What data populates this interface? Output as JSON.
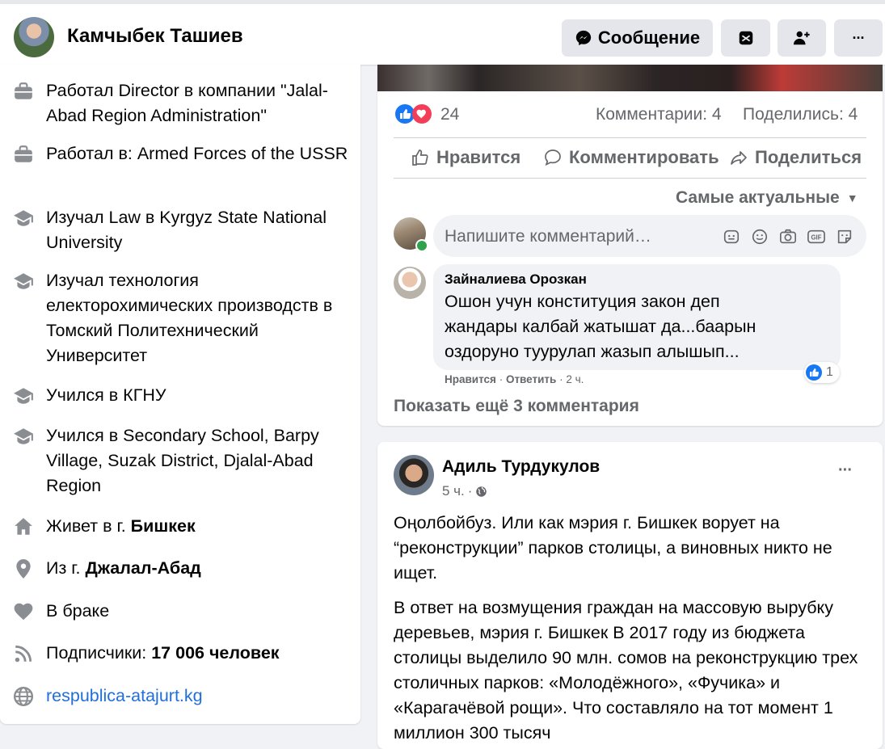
{
  "header": {
    "name": "Камчыбек Ташиев",
    "message_label": "Сообщение",
    "avatar_icon": "profile-avatar",
    "buttons": [
      "messenger-icon",
      "inbox-icon",
      "add-friend-icon",
      "more-icon"
    ],
    "more_label": "···"
  },
  "about": {
    "items": [
      {
        "icon": "briefcase-icon",
        "text": "Работал Director в компании \"Jalal-Abad Region Administration\""
      },
      {
        "icon": "briefcase-icon",
        "text": "Работал в: Armed Forces of the USSR"
      },
      {
        "icon": "graduation-cap-icon",
        "text": "Изучал Law в Kyrgyz State National University"
      },
      {
        "icon": "graduation-cap-icon",
        "text": "Изучал технология електорохимических производств в Томский Политехнический Университет"
      },
      {
        "icon": "graduation-cap-icon",
        "text": "Учился в КГНУ"
      },
      {
        "icon": "graduation-cap-icon",
        "text": "Учился в Secondary School, Barpy Village, Suzak District, Djalal-Abad Region"
      },
      {
        "icon": "home-icon",
        "text_prefix": "Живет в г. ",
        "text_bold": "Бишкек"
      },
      {
        "icon": "location-icon",
        "text_prefix": "Из г. ",
        "text_bold": "Джалал-Абад"
      },
      {
        "icon": "heart-icon",
        "text": "В браке"
      },
      {
        "icon": "rss-icon",
        "text_prefix": "Подписчики: ",
        "text_bold": "17 006 человек"
      },
      {
        "icon": "globe-icon",
        "link": "respublica-atajurt.kg"
      }
    ]
  },
  "post1": {
    "reaction_count": "24",
    "comments_count": "Комментарии: 4",
    "shares_count": "Поделились: 4",
    "like_label": "Нравится",
    "comment_label": "Комментировать",
    "share_label": "Поделиться",
    "sort_label": "Самые актуальные",
    "comment_placeholder": "Напишите комментарий…",
    "comment": {
      "author": "Зайналиева Орозкан",
      "text": "Ошон учун конституция закон деп жандары калбай жатышат да...баарын оздоруно туурулап жазып алышып...",
      "like": "Нравится",
      "reply": "Ответить",
      "time": "2 ч.",
      "reactions": "1"
    },
    "more_comments": "Показать ещё 3 комментария"
  },
  "post2": {
    "author": "Адиль Турдукулов",
    "time": "5 ч.",
    "more_label": "···",
    "paragraph1": "Оңолбойбуз. Или как мэрия г. Бишкек ворует на “реконструкции” парков столицы, а виновных никто не ищет.",
    "paragraph2": "В ответ на возмущения граждан на массовую вырубку деревьев, мэрия г. Бишкек В 2017 году из бюджета столицы выделило 90 млн. сомов на реконструкцию трех столичных парков: «Молодёжного», «Фучика» и «Карагачёвой рощи». Что составляло на тот момент 1 миллион 300 тысяч"
  },
  "colors": {
    "accent": "#1877f2",
    "link": "#216fdb",
    "secondary_text": "#65676b",
    "background": "#f0f2f5"
  }
}
